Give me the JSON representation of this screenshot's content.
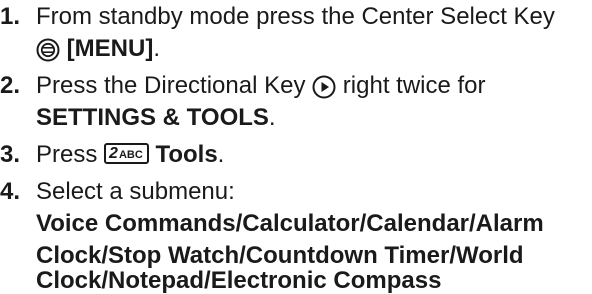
{
  "steps": [
    {
      "number": "1.",
      "line1": "From standby mode press the Center Select Key",
      "menu": "[MENU]",
      "menu_suffix": ".",
      "icon": "center-select-key-icon"
    },
    {
      "number": "2.",
      "pre": "Press the Directional Key",
      "post": "right twice for",
      "target": "SETTINGS & TOOLS",
      "target_suffix": ".",
      "icon": "directional-right-key-icon"
    },
    {
      "number": "3.",
      "pre": "Press",
      "key_digit": "2",
      "key_letters": "ABC",
      "target": "Tools",
      "target_suffix": ".",
      "icon": "key-2abc-icon"
    },
    {
      "number": "4.",
      "text": "Select a submenu:",
      "submenu_lines": [
        "Voice Commands/Calculator/Calendar/Alarm",
        "Clock/Stop Watch/Countdown Timer/World",
        "Clock/Notepad/Electronic Compass"
      ]
    }
  ]
}
